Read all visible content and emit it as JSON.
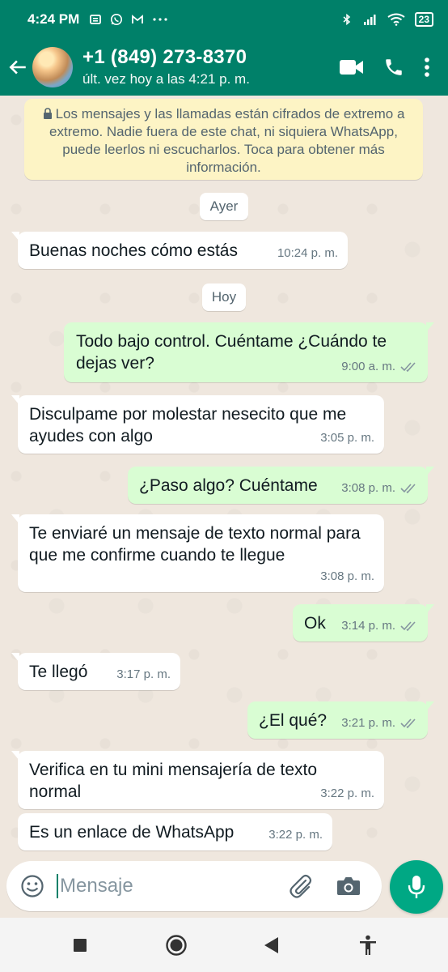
{
  "status_bar": {
    "time": "4:24 PM",
    "battery": "23",
    "icons": [
      "sim-card-icon",
      "whatsapp-icon",
      "gmail-icon",
      "more-dots-icon",
      "bluetooth-icon",
      "signal-icon",
      "wifi-icon",
      "battery-icon"
    ]
  },
  "header": {
    "contact_name": "+1 (849) 273-8370",
    "contact_status": "últ. vez hoy a las 4:21 p. m.",
    "actions": [
      "video-call-icon",
      "voice-call-icon",
      "menu-icon"
    ]
  },
  "chat": {
    "encryption_notice": "Los mensajes y las llamadas están cifrados de extremo a extremo. Nadie fuera de este chat, ni siquiera WhatsApp, puede leerlos ni escucharlos. Toca para obtener más información.",
    "day_yesterday": "Ayer",
    "day_today": "Hoy",
    "messages": [
      {
        "direction": "in",
        "text": "Buenas noches cómo estás",
        "time": "10:24 p. m."
      },
      {
        "direction": "out",
        "text": "Todo bajo control. Cuéntame ¿Cuándo te dejas ver?",
        "time": "9:00 a. m.",
        "read": true
      },
      {
        "direction": "in",
        "text": "Disculpame por molestar nesecito que me ayudes con algo",
        "time": "3:05 p. m."
      },
      {
        "direction": "out",
        "text": "¿Paso algo? Cuéntame",
        "time": "3:08 p. m.",
        "read": true
      },
      {
        "direction": "in",
        "text": "Te enviaré un mensaje de texto normal para que me confirme cuando te llegue",
        "time": "3:08 p. m."
      },
      {
        "direction": "out",
        "text": "Ok",
        "time": "3:14 p. m.",
        "read": true
      },
      {
        "direction": "in",
        "text": "Te llegó",
        "time": "3:17 p. m."
      },
      {
        "direction": "out",
        "text": "¿El qué?",
        "time": "3:21 p. m.",
        "read": true
      },
      {
        "direction": "in",
        "text": "Verifica en tu mini mensajería de texto normal",
        "time": "3:22 p. m."
      },
      {
        "direction": "in",
        "text": "Es un enlace de WhatsApp",
        "time": "3:22 p. m."
      }
    ]
  },
  "composer": {
    "placeholder": "Mensaje"
  },
  "colors": {
    "header": "#008069",
    "incoming_bubble": "#ffffff",
    "outgoing_bubble": "#d9fdd3",
    "read_ticks": "#8696a0",
    "mic_button": "#00a884",
    "chat_background": "#efe7de",
    "notice_background": "#fdf4c5"
  }
}
